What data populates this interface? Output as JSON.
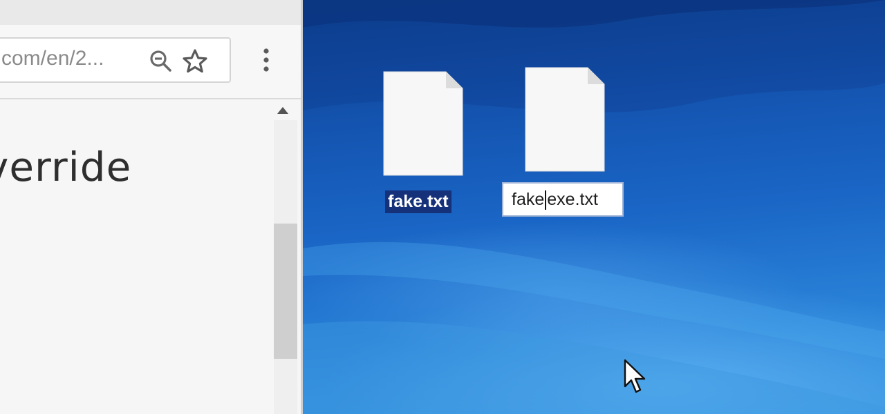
{
  "browser": {
    "url_text": "com/en/2...",
    "page_heading": "verride",
    "icons": {
      "zoom": "magnifier-minus-icon",
      "bookmark": "star-icon",
      "menu": "three-dot-menu-icon",
      "scroll_up": "scroll-up-arrow-icon"
    }
  },
  "desktop": {
    "files": [
      {
        "name": "fake.txt",
        "state": "selected"
      },
      {
        "name_before_caret": "fake",
        "name_after_caret": "exe.txt",
        "state": "renaming"
      }
    ],
    "cursor": "arrow-cursor-icon"
  },
  "colors": {
    "desktop_blue": "#1a5fb8",
    "selection_blue": "#14317a",
    "browser_bg": "#f4f4f4"
  }
}
